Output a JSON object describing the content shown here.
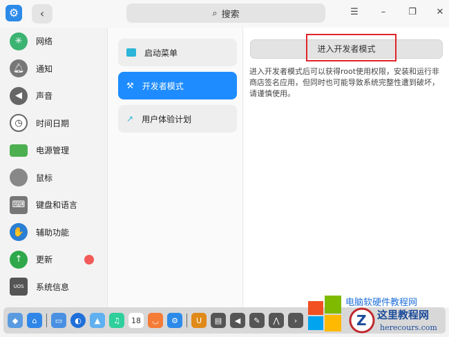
{
  "titlebar": {
    "search_placeholder": "搜索",
    "menu_icon": "☰",
    "minimize": "–",
    "maximize": "❐",
    "close": "✕"
  },
  "sidebar": {
    "items": [
      {
        "label": "网络",
        "icon": "network-icon",
        "color": "#3cb371"
      },
      {
        "label": "通知",
        "icon": "bell-icon",
        "color": "#777777"
      },
      {
        "label": "声音",
        "icon": "speaker-icon",
        "color": "#666666"
      },
      {
        "label": "时间日期",
        "icon": "clock-icon",
        "color": "#999999"
      },
      {
        "label": "电源管理",
        "icon": "battery-icon",
        "color": "#4caf50"
      },
      {
        "label": "鼠标",
        "icon": "mouse-icon",
        "color": "#888888"
      },
      {
        "label": "键盘和语言",
        "icon": "keyboard-icon",
        "color": "#777777"
      },
      {
        "label": "辅助功能",
        "icon": "accessibility-icon",
        "color": "#2a7fd4"
      },
      {
        "label": "更新",
        "icon": "update-icon",
        "color": "#2ea84a"
      },
      {
        "label": "系统信息",
        "icon": "system-info-icon",
        "color": "#555555"
      }
    ]
  },
  "middle": {
    "items": [
      {
        "label": "启动菜单"
      },
      {
        "label": "开发者模式"
      },
      {
        "label": "用户体验计划"
      }
    ]
  },
  "right": {
    "button": "进入开发者模式",
    "description": "进入开发者模式后可以获得root使用权限，安装和运行非商店签名应用，但同时也可能导致系统完整性遭到破坏，请谨慎使用。"
  },
  "dock": {
    "calendar_day": "18"
  },
  "watermark": {
    "line1": "电脑软硬件教程网",
    "line2": "这里教程网",
    "line3": "herecours.com"
  },
  "colors": {
    "accent": "#1e8cff",
    "highlight": "#e0242a"
  }
}
